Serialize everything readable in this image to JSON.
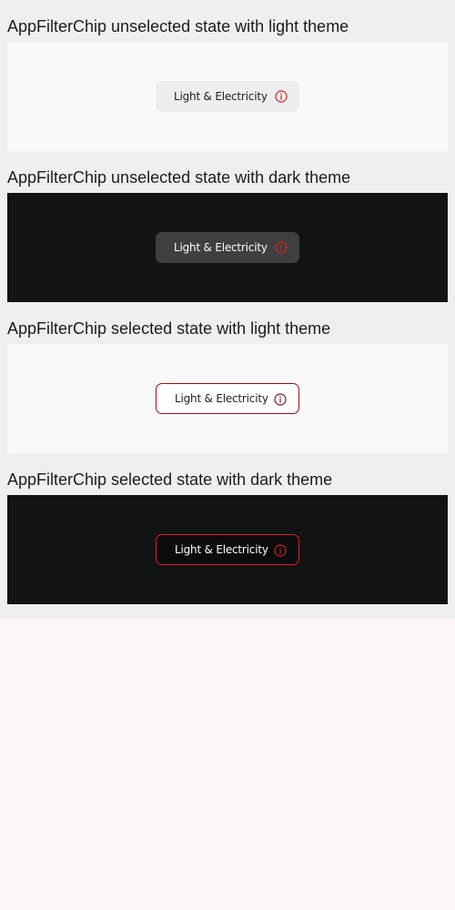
{
  "sections": [
    {
      "title": "AppFilterChip unselected state with light theme",
      "chip": {
        "label": "Light & Electricity",
        "icon": "info-icon",
        "selected": false,
        "theme": "light"
      }
    },
    {
      "title": "AppFilterChip unselected state with dark theme",
      "chip": {
        "label": "Light & Electricity",
        "icon": "info-icon",
        "selected": false,
        "theme": "dark"
      }
    },
    {
      "title": "AppFilterChip selected state with light theme",
      "chip": {
        "label": "Light & Electricity",
        "icon": "info-icon",
        "selected": true,
        "theme": "light"
      }
    },
    {
      "title": "AppFilterChip selected state with dark theme",
      "chip": {
        "label": "Light & Electricity",
        "icon": "info-icon",
        "selected": true,
        "theme": "dark"
      }
    }
  ],
  "colors": {
    "accent_red": "#d2232a",
    "accent_dark_red": "#8f1218",
    "light_bg": "#f9f9f9",
    "dark_bg": "#121313",
    "page_bg": "#efefef"
  }
}
